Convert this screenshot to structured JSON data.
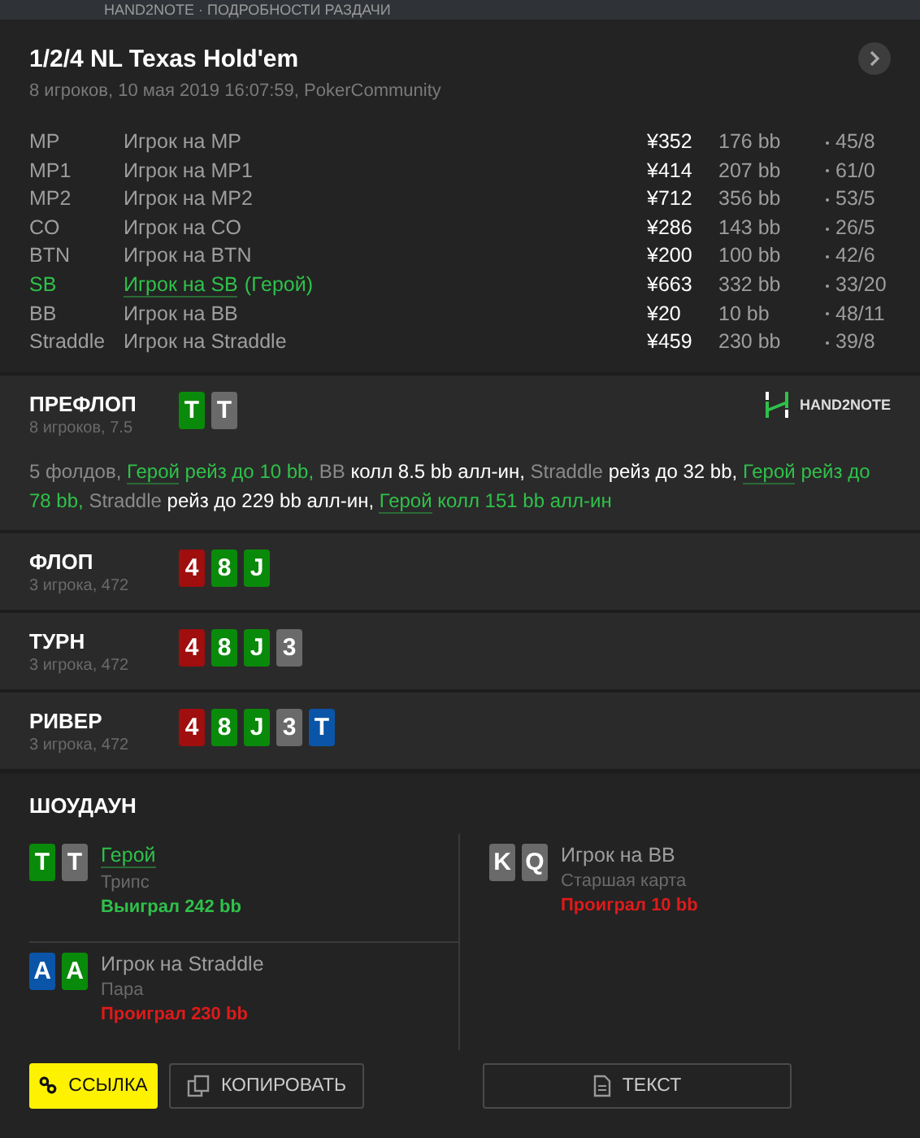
{
  "window": {
    "title": "HAND2NOTE · ПОДРОБНОСТИ РАЗДАЧИ"
  },
  "hand": {
    "title": "1/2/4 NL Texas Hold'em",
    "subtitle": "8 игроков, 10 мая 2019 16:07:59, PokerCommunity"
  },
  "players": [
    {
      "position": "MP",
      "name": "Игрок на MP",
      "hero": false,
      "stack": "¥352",
      "bb": "176 bb",
      "stats": "45/8"
    },
    {
      "position": "MP1",
      "name": "Игрок на MP1",
      "hero": false,
      "stack": "¥414",
      "bb": "207 bb",
      "stats": "61/0"
    },
    {
      "position": "MP2",
      "name": "Игрок на MP2",
      "hero": false,
      "stack": "¥712",
      "bb": "356 bb",
      "stats": "53/5"
    },
    {
      "position": "CO",
      "name": "Игрок на CO",
      "hero": false,
      "stack": "¥286",
      "bb": "143 bb",
      "stats": "26/5"
    },
    {
      "position": "BTN",
      "name": "Игрок на BTN",
      "hero": false,
      "stack": "¥200",
      "bb": "100 bb",
      "stats": "42/6"
    },
    {
      "position": "SB",
      "name": "Игрок на SB",
      "hero": true,
      "hero_tag": "(Герой)",
      "stack": "¥663",
      "bb": "332 bb",
      "stats": "33/20"
    },
    {
      "position": "BB",
      "name": "Игрок на BB",
      "hero": false,
      "stack": "¥20",
      "bb": "10 bb",
      "stats": "48/11"
    },
    {
      "position": "Straddle",
      "name": "Игрок на Straddle",
      "hero": false,
      "stack": "¥459",
      "bb": "230 bb",
      "stats": "39/8"
    }
  ],
  "streets": [
    {
      "name": "ПРЕФЛОП",
      "info": "8 игроков, 7.5",
      "logo": "HAND2NOTE",
      "cards": [
        {
          "rank": "T",
          "color": "#0a8a0a"
        },
        {
          "rank": "T",
          "color": "#6a6a6a"
        }
      ],
      "actions": [
        {
          "kind": "player",
          "text": "5 фолдов,"
        },
        {
          "kind": "hero",
          "text": "Герой"
        },
        {
          "kind": "hero_action",
          "text": "рейз до 10 bb,"
        },
        {
          "kind": "player",
          "text": "BB"
        },
        {
          "kind": "action",
          "text": "колл 8.5 bb алл-ин,"
        },
        {
          "kind": "player",
          "text": "Straddle"
        },
        {
          "kind": "action",
          "text": "рейз до 32 bb,"
        },
        {
          "kind": "hero",
          "text": "Герой"
        },
        {
          "kind": "hero_action",
          "text": "рейз до 78 bb,"
        },
        {
          "kind": "player",
          "text": "Straddle"
        },
        {
          "kind": "action",
          "text": "рейз до 229 bb алл-ин,"
        },
        {
          "kind": "hero",
          "text": "Герой"
        },
        {
          "kind": "hero_action",
          "text": "колл 151 bb алл-ин"
        }
      ]
    },
    {
      "name": "ФЛОП",
      "info": "3 игрока, 472",
      "cards": [
        {
          "rank": "4",
          "color": "#a00e0e"
        },
        {
          "rank": "8",
          "color": "#0a8a0a"
        },
        {
          "rank": "J",
          "color": "#0a8a0a"
        }
      ]
    },
    {
      "name": "ТУРН",
      "info": "3 игрока, 472",
      "cards": [
        {
          "rank": "4",
          "color": "#a00e0e"
        },
        {
          "rank": "8",
          "color": "#0a8a0a"
        },
        {
          "rank": "J",
          "color": "#0a8a0a"
        },
        {
          "rank": "3",
          "color": "#6a6a6a"
        }
      ]
    },
    {
      "name": "РИВЕР",
      "info": "3 игрока, 472",
      "cards": [
        {
          "rank": "4",
          "color": "#a00e0e"
        },
        {
          "rank": "8",
          "color": "#0a8a0a"
        },
        {
          "rank": "J",
          "color": "#0a8a0a"
        },
        {
          "rank": "3",
          "color": "#6a6a6a"
        },
        {
          "rank": "T",
          "color": "#0a55a8"
        }
      ]
    }
  ],
  "showdown": {
    "title": "ШОУДАУН",
    "hands": [
      {
        "name": "Герой",
        "hero": true,
        "combo": "Трипс",
        "won": true,
        "result": "Выиграл 242 bb",
        "cards": [
          {
            "rank": "T",
            "color": "#0a8a0a"
          },
          {
            "rank": "T",
            "color": "#6a6a6a"
          }
        ]
      },
      {
        "name": "Игрок на BB",
        "hero": false,
        "combo": "Старшая карта",
        "won": false,
        "result": "Проиграл 10 bb",
        "cards": [
          {
            "rank": "K",
            "color": "#6a6a6a"
          },
          {
            "rank": "Q",
            "color": "#6a6a6a"
          }
        ]
      },
      {
        "name": "Игрок на Straddle",
        "hero": false,
        "combo": "Пара",
        "won": false,
        "result": "Проиграл 230 bb",
        "cards": [
          {
            "rank": "A",
            "color": "#0a55a8"
          },
          {
            "rank": "A",
            "color": "#0a8a0a"
          }
        ]
      }
    ]
  },
  "buttons": [
    {
      "kind": "link",
      "label": "ССЫЛКА"
    },
    {
      "kind": "copy",
      "label": "КОПИРОВАТЬ"
    },
    {
      "kind": "text",
      "label": "ТЕКСТ"
    }
  ]
}
